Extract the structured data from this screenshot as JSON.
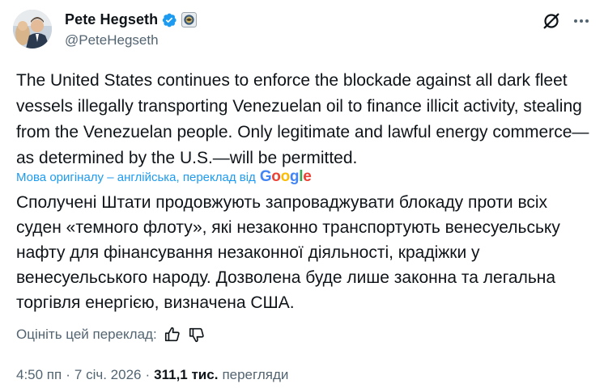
{
  "author": {
    "name": "Pete Hegseth",
    "handle": "@PeteHegseth"
  },
  "icons": {
    "verified": "verified-badge-icon",
    "affiliation": "government-seal-icon",
    "grok": "grok-icon",
    "more": "more-options-icon",
    "like": "thumbs-up-icon",
    "dislike": "thumbs-down-icon"
  },
  "colors": {
    "verified": "#1d9bf0",
    "link": "#1d9bf0",
    "secondary_text": "#536471",
    "primary_text": "#0f1419"
  },
  "tweet": {
    "text": "The United States continues to enforce the blockade against all dark fleet vessels illegally transporting Venezuelan oil to finance illicit activity, stealing from the Venezuelan people. Only legitimate and lawful energy commerce—as determined by the U.S.—will be permitted.",
    "translation_note": "Мова оригіналу – англійська, переклад від",
    "translation_provider": "Google",
    "translated_text": "Сполучені Штати продовжують запроваджувати блокаду проти всіх суден «темного флоту», які незаконно транспортують венесуельську нафту для фінансування незаконної діяльності, крадіжки у венесуельського народу. Дозволена буде лише законна та легальна торгівля енергією, визначена США."
  },
  "rate_translation": {
    "label": "Оцініть цей переклад:"
  },
  "meta": {
    "time": "4:50 пп",
    "date": "7 січ. 2026",
    "views_count": "311,1 тис.",
    "views_label": "перегляди",
    "separator": "·"
  }
}
